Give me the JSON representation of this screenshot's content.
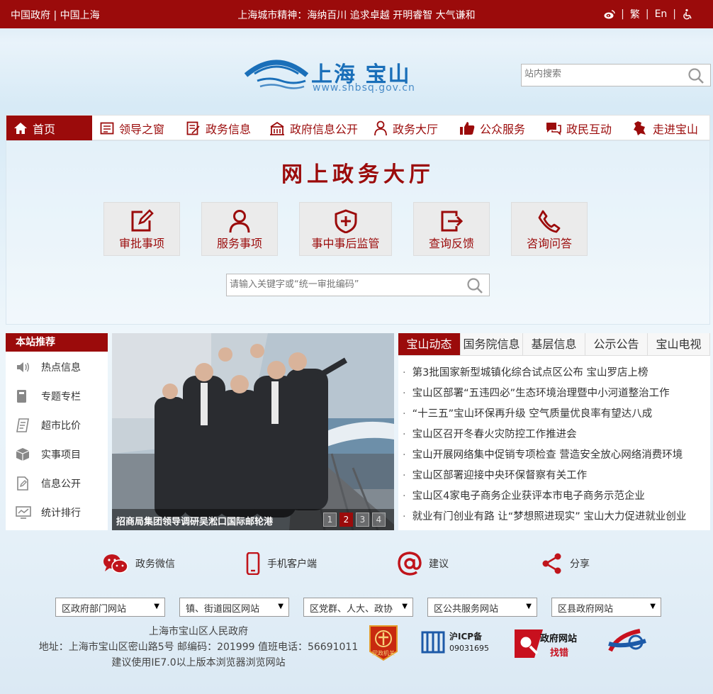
{
  "topbar": {
    "left_text": "中国政府 | 中国上海",
    "center_text": "上海城市精神：海纳百川 追求卓越 开明睿智 大气谦和",
    "trad": "繁",
    "en": "En",
    "sep": "|"
  },
  "header": {
    "logo_title": "上海 宝山",
    "logo_url": "www.shbsq.gov.cn",
    "search_placeholder": "站内搜索"
  },
  "nav": [
    {
      "label": "首页",
      "icon": "home-icon"
    },
    {
      "label": "领导之窗",
      "icon": "leader-window-icon"
    },
    {
      "label": "政务信息",
      "icon": "document-icon"
    },
    {
      "label": "政府信息公开",
      "icon": "building-icon"
    },
    {
      "label": "政务大厅",
      "icon": "person-icon"
    },
    {
      "label": "公众服务",
      "icon": "thumbs-up-icon"
    },
    {
      "label": "政民互动",
      "icon": "chat-icon"
    },
    {
      "label": "走进宝山",
      "icon": "map-icon"
    }
  ],
  "hall": {
    "title": "网上政务大厅",
    "tiles": [
      {
        "label": "审批事项",
        "icon": "edit-icon"
      },
      {
        "label": "服务事项",
        "icon": "user-icon"
      },
      {
        "label": "事中事后监管",
        "icon": "shield-plus-icon"
      },
      {
        "label": "查询反馈",
        "icon": "exit-icon"
      },
      {
        "label": "咨询问答",
        "icon": "phone-icon"
      }
    ],
    "search_placeholder": "请输入关键字或“统一审批编码”"
  },
  "recommend": {
    "heading": "本站推荐",
    "items": [
      {
        "label": "热点信息",
        "icon": "speaker-icon"
      },
      {
        "label": "专题专栏",
        "icon": "book-icon"
      },
      {
        "label": "超市比价",
        "icon": "receipt-icon"
      },
      {
        "label": "实事项目",
        "icon": "box-icon"
      },
      {
        "label": "信息公开",
        "icon": "file-edit-icon"
      },
      {
        "label": "统计排行",
        "icon": "chart-icon"
      }
    ]
  },
  "slider": {
    "caption": "招商局集团领导调研吴淞口国际邮轮港",
    "pages": [
      "1",
      "2",
      "3",
      "4"
    ],
    "active_page": "2"
  },
  "news": {
    "tabs": [
      "宝山动态",
      "国务院信息",
      "基层信息",
      "公示公告",
      "宝山电视"
    ],
    "bullet": "·",
    "items": [
      "第3批国家新型城镇化综合试点区公布 宝山罗店上榜",
      "宝山区部署“五违四必”生态环境治理暨中小河道整治工作",
      "“十三五”宝山环保再升级 空气质量优良率有望达八成",
      "宝山区召开冬春火灾防控工作推进会",
      "宝山开展网络集中促销专项检查 营造安全放心网络消费环境",
      "宝山区部署迎接中央环保督察有关工作",
      "宝山区4家电子商务企业获评本市电子商务示范企业",
      "就业有门创业有路 让“梦想照进现实” 宝山大力促进就业创业"
    ]
  },
  "links": [
    {
      "label": "政务微信",
      "icon": "wechat-icon"
    },
    {
      "label": "手机客户端",
      "icon": "mobile-icon"
    },
    {
      "label": "建议",
      "icon": "at-icon"
    },
    {
      "label": "分享",
      "icon": "share-icon"
    }
  ],
  "selects": [
    "区政府部门网站",
    "镇、街道园区网站",
    "区党群、人大、政协",
    "区公共服务网站",
    "区县政府网站"
  ],
  "footer": {
    "line1": "上海市宝山区人民政府",
    "line2": "地址：上海市宝山区密山路5号 邮编码：201999 值班电话：56691011",
    "line3": "建议使用IE7.0以上版本浏览器浏览网站",
    "icp_title": "沪ICP备",
    "icp_number": "09031695",
    "error_title": "政府网站",
    "error_sub": "找错",
    "party_badge": "党政机关"
  },
  "colors": {
    "brand": "#9b0b0b",
    "logo_blue": "#1a6fb9"
  }
}
